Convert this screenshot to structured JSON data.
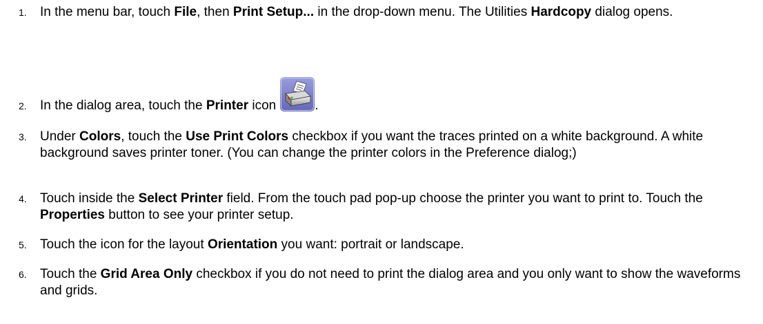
{
  "steps": [
    {
      "number": "1.",
      "parts": [
        {
          "t": "In the menu bar, touch "
        },
        {
          "t": "File",
          "b": true
        },
        {
          "t": ", then "
        },
        {
          "t": "Print Setup...",
          "b": true
        },
        {
          "t": " in the drop-down menu. The Utilities "
        },
        {
          "t": "Hardcopy",
          "b": true
        },
        {
          "t": " dialog opens."
        }
      ]
    },
    {
      "number": "2.",
      "parts": [
        {
          "t": "In the dialog area, touch the "
        },
        {
          "t": "Printer",
          "b": true
        },
        {
          "t": " icon"
        }
      ],
      "icon": "printer-icon",
      "after_icon": "."
    },
    {
      "number": "3.",
      "parts": [
        {
          "t": "Under "
        },
        {
          "t": "Colors",
          "b": true
        },
        {
          "t": ", touch the "
        },
        {
          "t": "Use Print Colors",
          "b": true
        },
        {
          "t": " checkbox if you want the traces printed on a white background. A white background saves printer toner. (You can change the printer colors in the Preference dialog;)"
        }
      ]
    },
    {
      "number": "4.",
      "parts": [
        {
          "t": "Touch inside the "
        },
        {
          "t": "Select Printer",
          "b": true
        },
        {
          "t": " field. From the touch pad pop-up choose the printer you want to print to. Touch the "
        },
        {
          "t": "Properties",
          "b": true
        },
        {
          "t": " button to see your printer setup."
        }
      ]
    },
    {
      "number": "5.",
      "parts": [
        {
          "t": "Touch the icon for the layout "
        },
        {
          "t": "Orientation",
          "b": true
        },
        {
          "t": " you want: portrait or landscape."
        }
      ]
    },
    {
      "number": "6.",
      "parts": [
        {
          "t": "Touch the "
        },
        {
          "t": "Grid Area Only",
          "b": true
        },
        {
          "t": " checkbox if you do not need to print the dialog area and you only want to show the waveforms and grids."
        }
      ]
    }
  ]
}
